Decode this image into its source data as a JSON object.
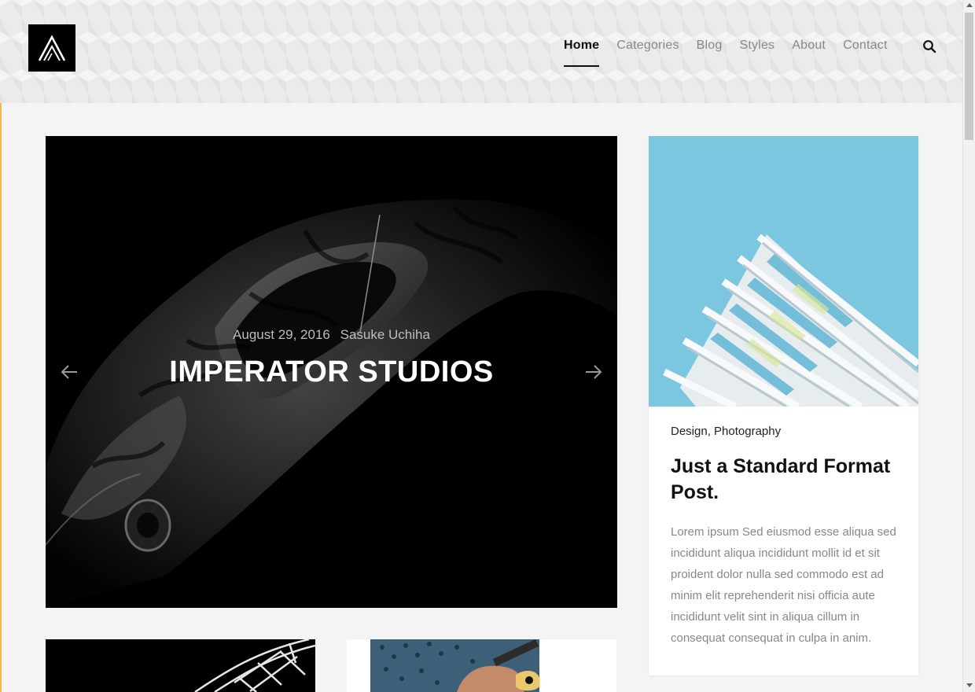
{
  "header": {
    "logo_name": "site-logo",
    "nav": [
      {
        "label": "Home",
        "active": true
      },
      {
        "label": "Categories",
        "active": false
      },
      {
        "label": "Blog",
        "active": false
      },
      {
        "label": "Styles",
        "active": false
      },
      {
        "label": "About",
        "active": false
      },
      {
        "label": "Contact",
        "active": false
      }
    ],
    "search_icon": "search-icon"
  },
  "hero": {
    "date": "August 29, 2016",
    "author": "Sasuke Uchiha",
    "title": "IMPERATOR STUDIOS",
    "prev_icon": "arrow-left-icon",
    "next_icon": "arrow-right-icon"
  },
  "featured_post": {
    "categories": "Design, Photography",
    "title": "Just a Standard Format Post.",
    "excerpt": "Lorem ipsum Sed eiusmod esse aliqua sed incididunt aliqua incididunt mollit id et sit proident dolor nulla sed commodo est ad minim elit reprehenderit nisi officia aute incididunt velit sint in aliqua cillum in consequat consequat in culpa in anim."
  },
  "colors": {
    "accent": "#f4b94a",
    "nav_active": "#111111",
    "nav_inactive": "#888888",
    "sky": "#7cc7e0"
  }
}
